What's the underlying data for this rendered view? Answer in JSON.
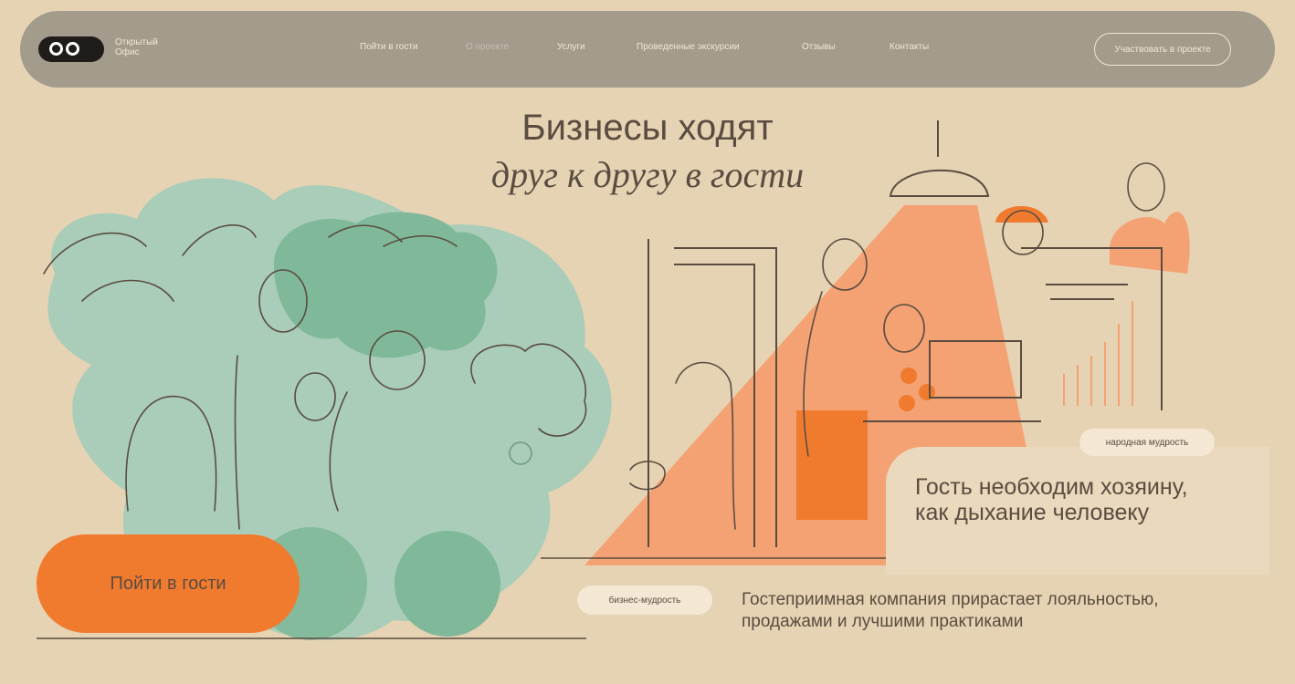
{
  "header": {
    "brand_line1": "Открытый",
    "brand_line2": "Офис",
    "nav": [
      "Пойти в гости",
      "О проекте",
      "Услуги",
      "Проведенные экскурсии",
      "Отзывы",
      "Контакты"
    ],
    "cta": "Участвовать в проекте"
  },
  "hero": {
    "title": "Бизнесы ходят",
    "subtitle": "друг к другу в гости"
  },
  "main_button": "Пойти в гости",
  "folk": {
    "tag": "народная мудрость",
    "quote_line1": "Гость необходим хозяину,",
    "quote_line2": "как дыхание человеку"
  },
  "business": {
    "tag": "бизнес-мудрость",
    "text_line1": "Гостеприимная компания прирастает лояльностью,",
    "text_line2": "продажами и лучшими практиками"
  },
  "colors": {
    "background": "#E6D3B3",
    "header": "#A39B8C",
    "accent": "#F07B2E",
    "mint": "#A9CDB9",
    "green": "#7FB99A",
    "salmon": "#F4A273"
  }
}
